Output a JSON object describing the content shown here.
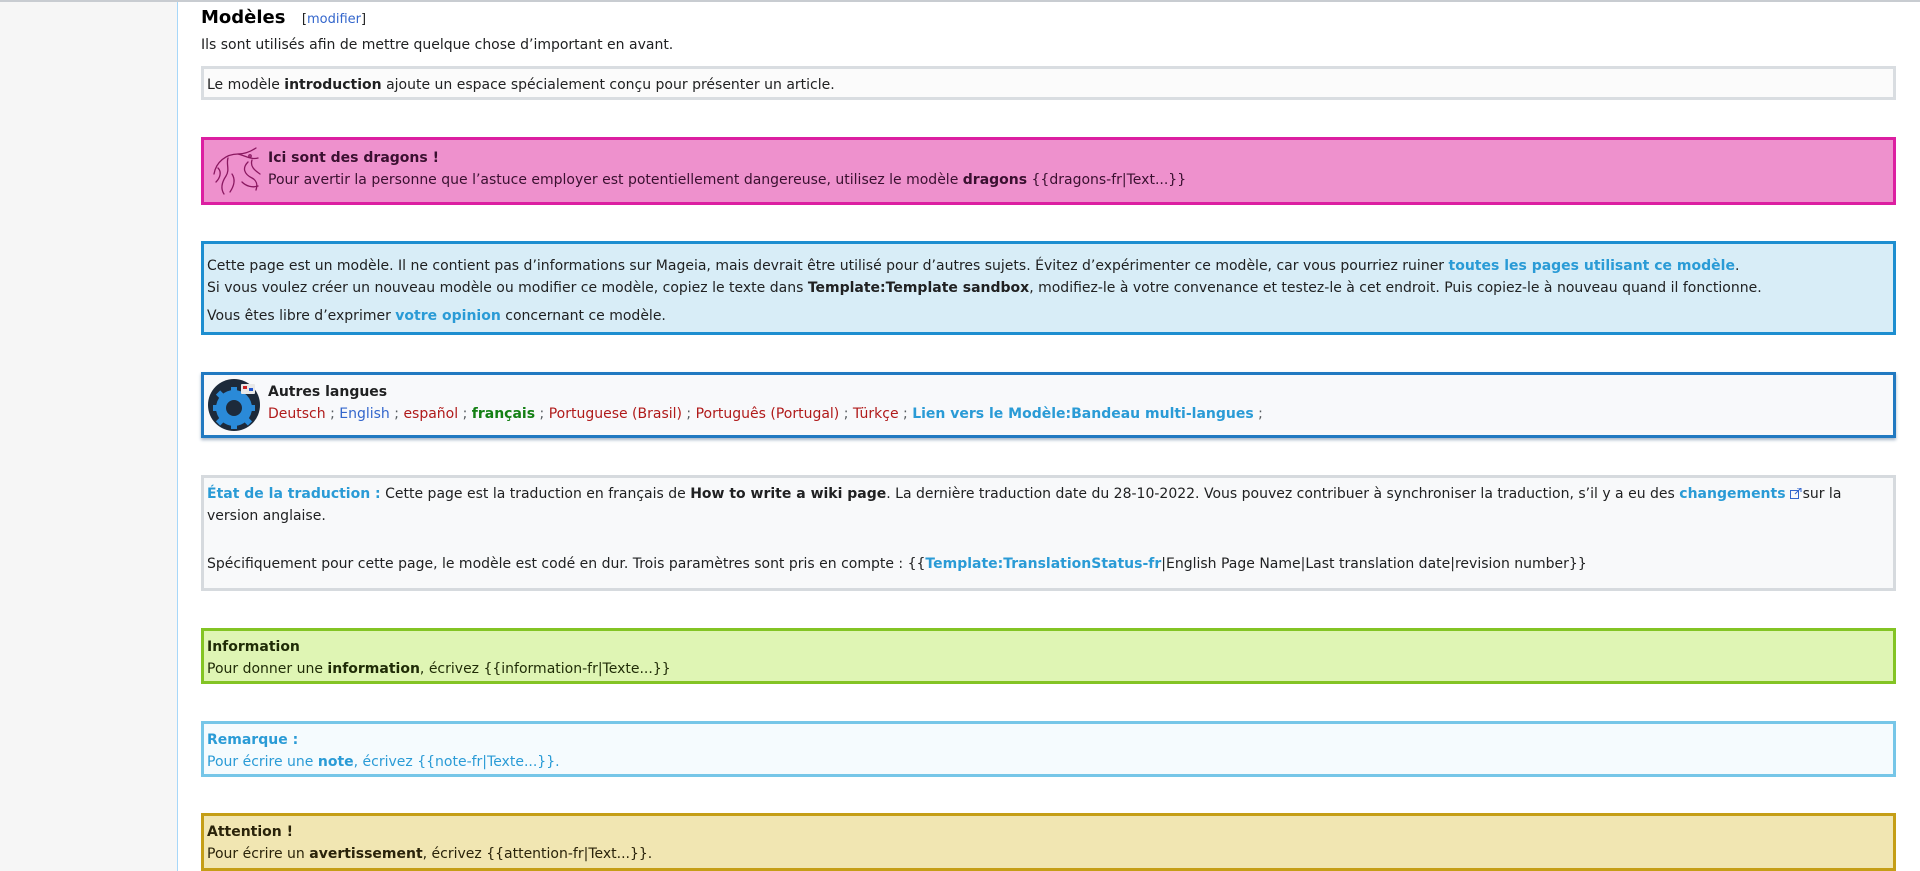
{
  "section": {
    "title": "Modèles",
    "edit_open": "[",
    "edit_link": "modifier",
    "edit_close": "]",
    "intro": "Ils sont utilisés afin de mettre quelque chose d’important en avant."
  },
  "intro_box": {
    "pre": "Le modèle ",
    "bold": "introduction",
    "post": " ajoute un espace spécialement conçu pour présenter un article."
  },
  "dragons_box": {
    "title": "Ici sont des dragons !",
    "pre": "Pour avertir la personne que l’astuce employer est potentiellement dangereuse, utilisez le modèle ",
    "bold": "dragons",
    "code": " {{dragons-fr|Text...}}",
    "icon": "dragon-icon",
    "border_color": "#dc1fa1",
    "bg_color": "#ee91cd"
  },
  "template_box": {
    "line1_pre": "Cette page est un modèle. Il ne contient pas d’informations sur Mageia, mais devrait être utilisé pour d’autres sujets. Évitez d’expérimenter ce modèle, car vous pourriez ruiner ",
    "line1_link": "toutes les pages utilisant ce modèle",
    "line1_post": ".",
    "line2_pre": "Si vous voulez créer un nouveau modèle ou modifier ce modèle, copiez le texte dans ",
    "line2_bold": "Template:Template sandbox",
    "line2_post": ", modifiez-le à votre convenance et testez-le à cet endroit. Puis copiez-le à nouveau quand il fonctionne.",
    "line3_pre": "Vous êtes libre d’exprimer ",
    "line3_link": "votre opinion",
    "line3_post": " concernant ce modèle."
  },
  "languages_box": {
    "title": "Autres langues",
    "icon": "language-gear-icon",
    "languages": [
      "Deutsch",
      "English",
      "español",
      "français",
      "Portuguese (Brasil)",
      "Português (Portugal)",
      "Türkçe"
    ],
    "separator": " ; ",
    "link": "Lien vers le Modèle:Bandeau multi-langues",
    "trailing": " ;"
  },
  "translation_box": {
    "label": "État de la traduction :",
    "pre": " Cette page est la traduction en français de ",
    "bold": "How to write a wiki page",
    "mid": ". La dernière traduction date du 28-10-2022. Vous pouvez contribuer à synchroniser la traduction, s’il y a eu des ",
    "link": "changements",
    "post": "sur la version anglaise.",
    "spec_pre": "Spécifiquement pour cette page, le modèle est codé en dur. Trois paramètres sont pris en compte : {{",
    "spec_link": "Template:TranslationStatus-fr",
    "spec_post": "|English Page Name|Last translation date|revision number}}"
  },
  "information_box": {
    "title": "Information",
    "pre": "Pour donner une ",
    "bold": "information",
    "post": ", écrivez {{information-fr|Texte...}}"
  },
  "note_box": {
    "title": "Remarque :",
    "pre": "Pour écrire une ",
    "bold": "note",
    "post": ", écrivez {{note-fr|Texte...}}."
  },
  "attention_box": {
    "title": "Attention !",
    "pre": "Pour écrire un ",
    "bold": "avertissement",
    "post": ", écrivez {{attention-fr|Text...}}."
  }
}
